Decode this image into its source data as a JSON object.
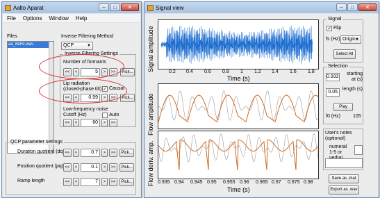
{
  "left_window": {
    "title": "Aalto Aparat",
    "menu": [
      "File",
      "Options",
      "Window",
      "Help"
    ],
    "files_label": "Files",
    "file_item": "aa_8kHz.wav",
    "inverse_filtering_method_label": "Inverse Filtering Method",
    "method_value": "QCP",
    "ifs_panel_title": "Inverse Filtering Settings",
    "num_formants_label": "Number of formants",
    "num_formants_value": "5",
    "lip_radiation_label": "Lip radiation",
    "lip_radiation_sub": "(closed-phase tilt)",
    "causal_label": "Causal",
    "lip_value": "0.99",
    "lowfreq_label": "Low-frequency noise",
    "cutoff_label": "Cutoff (Hz)",
    "auto_label": "Auto",
    "cutoff_value": "60",
    "qcp_panel_title": "QCP parameter settings",
    "dq_label": "Duration quotient (dq)",
    "dq_value": "0.7",
    "pq_label": "Position quotient (pq)",
    "pq_value": "0.1",
    "ramp_label": "Ramp length",
    "ramp_value": "7",
    "btn_dbl_left": "<<",
    "btn_left": "<",
    "btn_right": ">",
    "btn_dbl_right": ">>",
    "pick": "Pick..."
  },
  "right_window": {
    "title": "Signal view",
    "signal_panel": "Signal",
    "flip_label": "Flip",
    "fs_label": "fs (Hz)",
    "fs_value": "Origin...",
    "select_all": "Select All",
    "selection_panel": "Selection",
    "starting_value": "0.933",
    "starting_label": "starting at (s)",
    "length_value": "0.05",
    "length_label": "length (s)",
    "play": "Play",
    "f0_label": "f0 (Hz)",
    "f0_value": "105",
    "notes_label": "User's notes (optional)",
    "numeral_label": "numeral 1-5 or verbal",
    "save_mat": "Save as .mat",
    "export_wav": "Export as .wav"
  },
  "plots": {
    "top": {
      "ylabel": "Signal amplitude",
      "xlabel": "Time (s)",
      "xticks": [
        "0.2",
        "0.4",
        "0.6",
        "0.8",
        "1",
        "1.2",
        "1.4",
        "1.6",
        "1.8"
      ]
    },
    "mid": {
      "ylabel": "Flow amplitude"
    },
    "bot": {
      "ylabel": "Flow deriv. amp.",
      "xlabel": "Time (s)",
      "xticks": [
        "0.935",
        "0.94",
        "0.945",
        "0.95",
        "0.955",
        "0.96",
        "0.965",
        "0.97",
        "0.975",
        "0.98"
      ]
    },
    "colors": {
      "signal": "#1f6fd1",
      "flow": "#d2691e",
      "ref": "#9a9a9a"
    }
  }
}
